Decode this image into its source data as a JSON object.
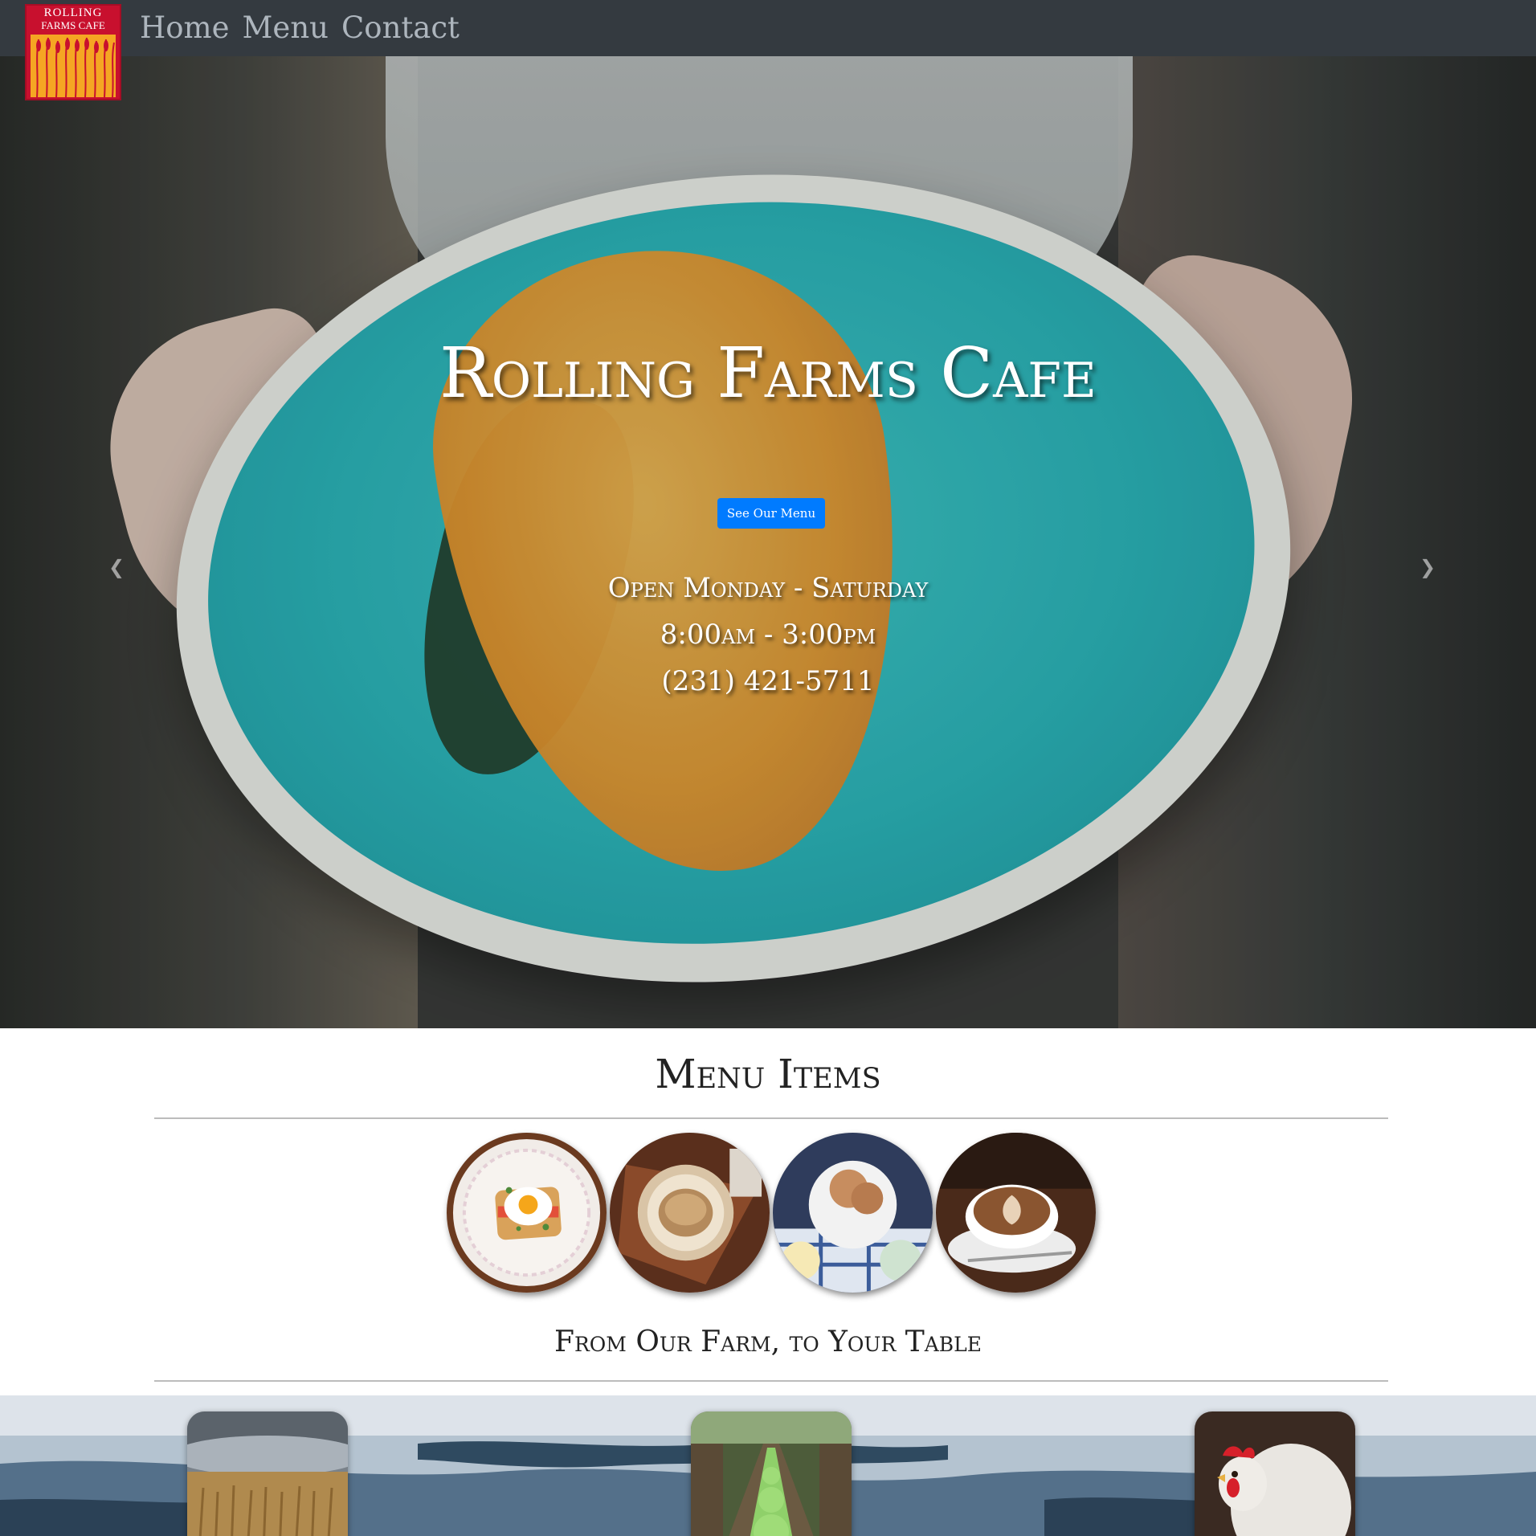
{
  "navbar": {
    "logo_line1": "ROLLING",
    "logo_line2": "FARMS CAFE",
    "links": [
      "Home",
      "Menu",
      "Contact"
    ]
  },
  "hero": {
    "title": "Rolling Farms Cafe",
    "button_label": "See Our Menu",
    "hours_days": "Open Monday - Saturday",
    "hours_time": "8:00am - 3:00pm",
    "phone": "(231) 421-5711",
    "prev_icon": "chevron-left-icon",
    "next_icon": "chevron-right-icon"
  },
  "menu_section": {
    "heading": "Menu Items",
    "items": [
      "egg-toast-image",
      "sandwich-image",
      "ice-cream-image",
      "latte-image"
    ]
  },
  "farm_section": {
    "heading": "From Our Farm, to Your Table",
    "cards": [
      "wheat-field-image",
      "lettuce-garden-image",
      "chicken-image"
    ]
  },
  "colors": {
    "navbar_bg": "#343a40",
    "nav_link": "#adb5bd",
    "button_bg": "#007bff",
    "logo_red": "#c8102e",
    "logo_gold": "#f5a623"
  }
}
